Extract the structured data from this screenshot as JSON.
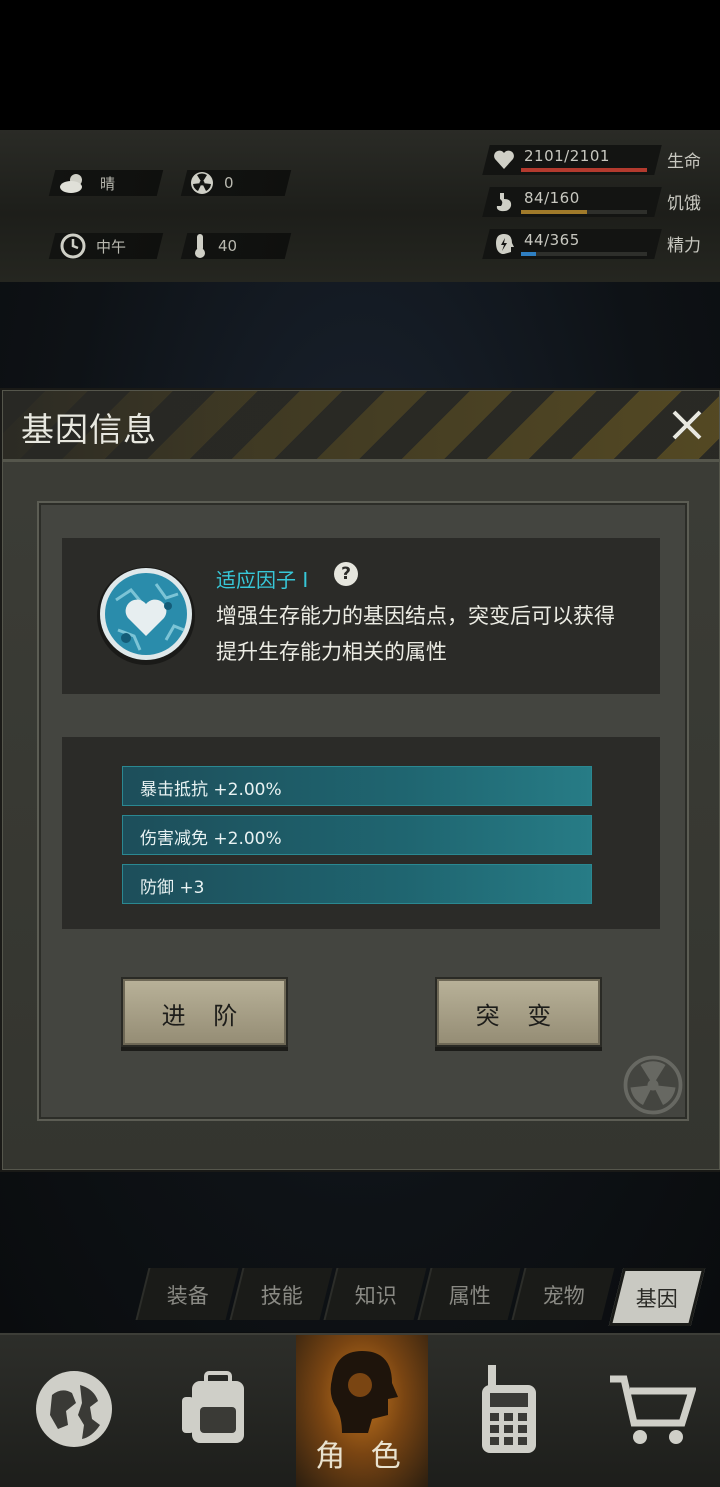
{
  "status": {
    "weather": "晴",
    "radiation": "0",
    "time_of_day": "中午",
    "temperature": "40",
    "health": {
      "value": "2101/2101",
      "label": "生命",
      "fraction": 1.0,
      "color": "#b33a2e"
    },
    "hunger": {
      "value": "84/160",
      "label": "饥饿",
      "fraction": 0.525,
      "color": "#a07a2a"
    },
    "energy": {
      "value": "44/365",
      "label": "精力",
      "fraction": 0.12,
      "color": "#2f7fc2"
    }
  },
  "dialog": {
    "title": "基因信息",
    "gene_name": "适应因子 I",
    "gene_desc_line1": "增强生存能力的基因结点，突变后可以获得",
    "gene_desc_line2": "提升生存能力相关的属性",
    "attributes": [
      "暴击抵抗 +2.00%",
      "伤害减免 +2.00%",
      "防御 +3"
    ],
    "advance_label": "进 阶",
    "mutate_label": "突 变"
  },
  "tabs": [
    "装备",
    "技能",
    "知识",
    "属性",
    "宠物",
    "基因"
  ],
  "active_tab": "基因",
  "bottom_nav": {
    "items": [
      "globe-icon",
      "backpack-icon",
      "character-icon",
      "radio-icon",
      "cart-icon"
    ],
    "active_label": "角 色"
  },
  "colors": {
    "accent_cyan": "#37c7d8",
    "attr_bar": "#1f6570"
  }
}
